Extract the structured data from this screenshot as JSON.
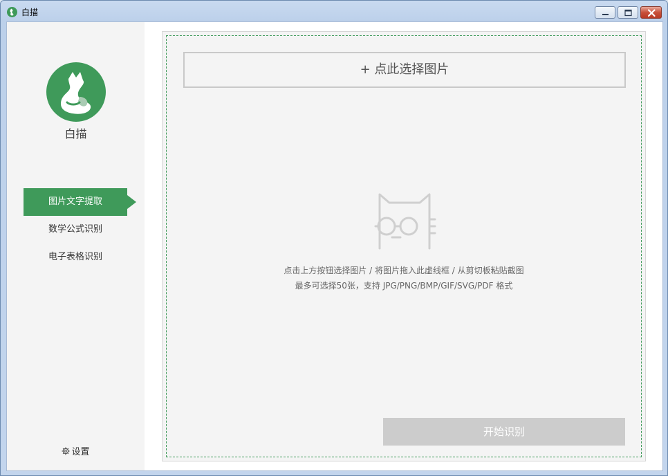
{
  "window": {
    "title": "白描",
    "controls": {
      "minimize": "minimize-icon",
      "maximize": "maximize-icon",
      "close": "close-icon"
    }
  },
  "sidebar": {
    "app_name": "白描",
    "items": [
      {
        "label": "图片文字提取",
        "active": true
      },
      {
        "label": "数学公式识别",
        "active": false
      },
      {
        "label": "电子表格识别",
        "active": false
      }
    ],
    "settings_label": "设置"
  },
  "main": {
    "select_button": "+ 点此选择图片",
    "hint_line1": "点击上方按钮选择图片 / 将图片拖入此虚线框 / 从剪切板粘贴截图",
    "hint_line2": "最多可选择50张，支持 JPG/PNG/BMP/GIF/SVG/PDF 格式",
    "start_button": "开始识别"
  },
  "colors": {
    "accent": "#3f9a5a",
    "sidebar_bg": "#f4f4f4",
    "disabled_button": "#cccccc"
  }
}
